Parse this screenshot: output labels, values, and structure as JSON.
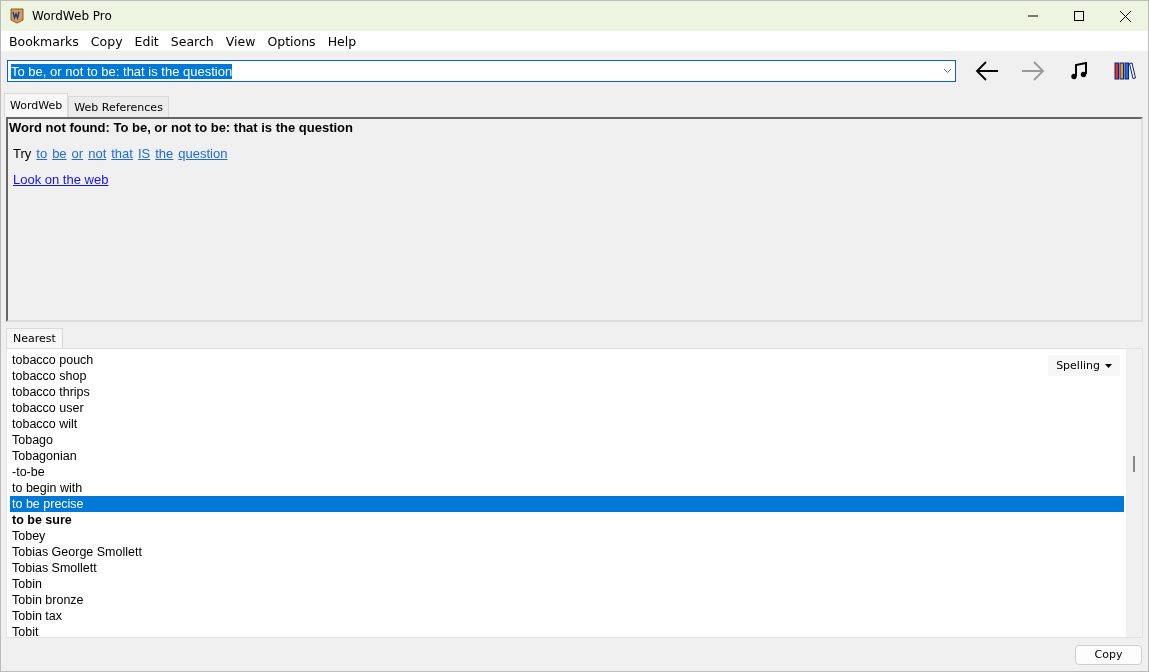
{
  "window": {
    "title": "WordWeb Pro"
  },
  "menu": [
    "Bookmarks",
    "Copy",
    "Edit",
    "Search",
    "View",
    "Options",
    "Help"
  ],
  "search": {
    "value": "To be, or not to be: that is the question"
  },
  "tabs": [
    {
      "label": "WordWeb",
      "selected": true
    },
    {
      "label": "Web References",
      "selected": false
    }
  ],
  "result": {
    "heading": "Word not found: To be, or not to be: that is the question",
    "try_label": "Try",
    "suggestions": [
      "to",
      "be",
      "or",
      "not",
      "that",
      "IS",
      "the",
      "question"
    ],
    "web_link": "Look on the web"
  },
  "nearest": {
    "tab": "Nearest",
    "mode": "Spelling",
    "items": [
      {
        "text": "tobacco pouch",
        "selected": false,
        "bold": false
      },
      {
        "text": "tobacco shop",
        "selected": false,
        "bold": false
      },
      {
        "text": "tobacco thrips",
        "selected": false,
        "bold": false
      },
      {
        "text": "tobacco user",
        "selected": false,
        "bold": false
      },
      {
        "text": "tobacco wilt",
        "selected": false,
        "bold": false
      },
      {
        "text": "Tobago",
        "selected": false,
        "bold": false
      },
      {
        "text": "Tobagonian",
        "selected": false,
        "bold": false
      },
      {
        "text": "-to-be",
        "selected": false,
        "bold": false
      },
      {
        "text": "to begin with",
        "selected": false,
        "bold": false
      },
      {
        "text": "to be precise",
        "selected": true,
        "bold": false
      },
      {
        "text": "to be sure",
        "selected": false,
        "bold": true
      },
      {
        "text": "Tobey",
        "selected": false,
        "bold": false
      },
      {
        "text": "Tobias George Smollett",
        "selected": false,
        "bold": false
      },
      {
        "text": "Tobias Smollett",
        "selected": false,
        "bold": false
      },
      {
        "text": "Tobin",
        "selected": false,
        "bold": false
      },
      {
        "text": "Tobin bronze",
        "selected": false,
        "bold": false
      },
      {
        "text": "Tobin tax",
        "selected": false,
        "bold": false
      },
      {
        "text": "Tobit",
        "selected": false,
        "bold": false
      }
    ]
  },
  "footer": {
    "button": "Copy"
  }
}
